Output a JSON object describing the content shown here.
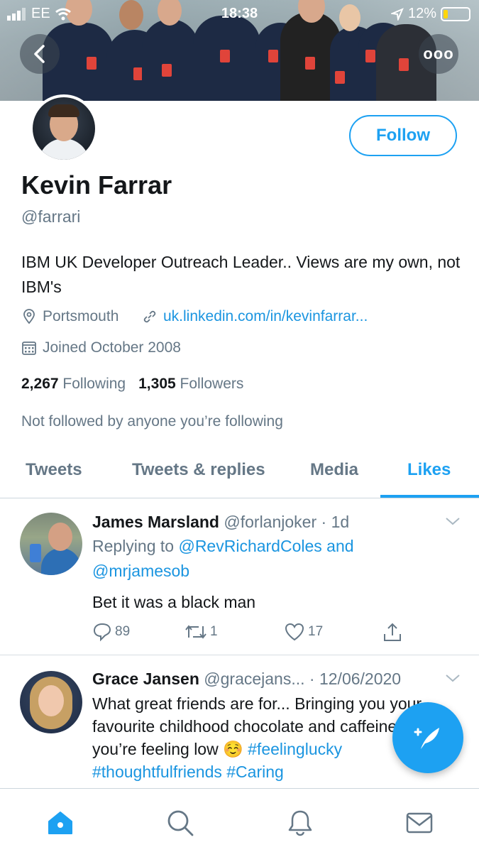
{
  "status_bar": {
    "carrier": "EE",
    "time": "18:38",
    "battery": "12%"
  },
  "header": {
    "back_icon": "chevron-left-icon",
    "more_icon": "more-options-icon",
    "more_label": "ooo"
  },
  "profile": {
    "name": "Kevin Farrar",
    "handle": "@farrari",
    "follow_label": "Follow",
    "bio": "IBM UK Developer Outreach Leader.. Views are my own, not IBM's",
    "location": "Portsmouth",
    "website": "uk.linkedin.com/in/kevinfarrar...",
    "joined": "Joined October 2008",
    "following_count": "2,267",
    "following_label": "Following",
    "followers_count": "1,305",
    "followers_label": "Followers",
    "not_followed": "Not followed by anyone you’re following"
  },
  "tabs": [
    {
      "label": "Tweets",
      "active": false
    },
    {
      "label": "Tweets & replies",
      "active": false
    },
    {
      "label": "Media",
      "active": false
    },
    {
      "label": "Likes",
      "active": true
    }
  ],
  "tweets": [
    {
      "author_name": "James Marsland",
      "author_handle": "@forlanjoker",
      "time": "1d",
      "reply_prefix": "Replying to ",
      "reply_mention_1": "@RevRichardColes",
      "reply_and": " and",
      "reply_mention_2": "@mrjamesob",
      "text": "Bet it was a black man",
      "replies": "89",
      "retweets": "1",
      "likes": "17"
    },
    {
      "author_name": "Grace Jansen",
      "author_handle": "@gracejans...",
      "time": "12/06/2020",
      "text": "What great friends are for... Bringing you your favourite childhood chocolate and caffeine when you’re feeling low ☺️",
      "hashtags": "#feelinglucky #thoughtfulfriends #Caring"
    }
  ],
  "colors": {
    "accent": "#1da1f2",
    "link": "#1b95e0",
    "muted": "#657786",
    "text": "#14171a"
  },
  "bottom_nav": [
    {
      "icon": "home-icon",
      "active": true
    },
    {
      "icon": "search-icon",
      "active": false
    },
    {
      "icon": "notifications-bell-icon",
      "active": false
    },
    {
      "icon": "messages-envelope-icon",
      "active": false
    }
  ],
  "fab": {
    "icon": "compose-tweet-icon"
  }
}
